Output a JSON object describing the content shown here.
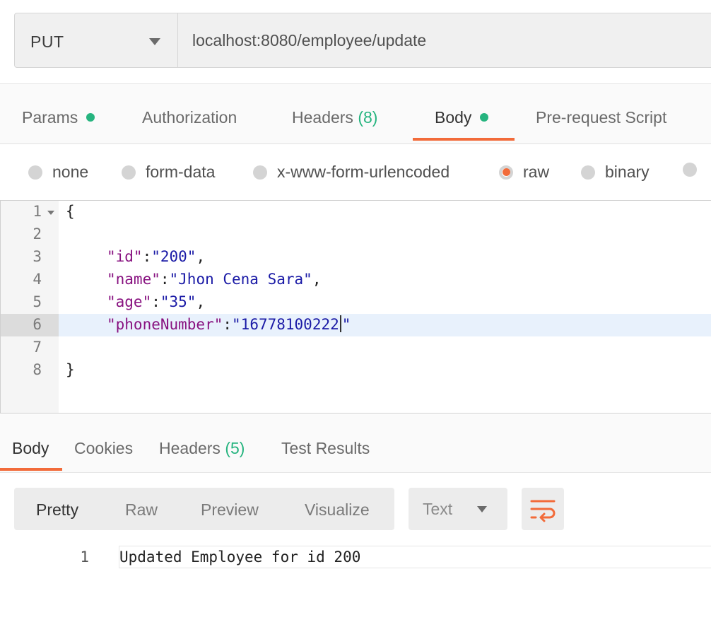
{
  "request": {
    "method": "PUT",
    "url": "localhost:8080/employee/update"
  },
  "request_tabs": {
    "params": "Params",
    "authorization": "Authorization",
    "headers": "Headers",
    "headers_count": "(8)",
    "body": "Body",
    "prerequest": "Pre-request Script",
    "active": "Body"
  },
  "body_types": {
    "none": "none",
    "form_data": "form-data",
    "urlencoded": "x-www-form-urlencoded",
    "raw": "raw",
    "binary": "binary",
    "selected": "raw"
  },
  "editor": {
    "line_numbers": [
      "1",
      "2",
      "3",
      "4",
      "5",
      "6",
      "7",
      "8"
    ],
    "active_line": "6",
    "open_brace": "{",
    "close_brace": "}",
    "fields": [
      {
        "key": "\"id\"",
        "value": "\"200\"",
        "trail": ","
      },
      {
        "key": "\"name\"",
        "value": "\"Jhon Cena Sara\"",
        "trail": ","
      },
      {
        "key": "\"age\"",
        "value": "\"35\"",
        "trail": ","
      },
      {
        "key": "\"phoneNumber\"",
        "value": "\"16778100222",
        "value_end": "\"",
        "trail": ""
      }
    ]
  },
  "response_tabs": {
    "body": "Body",
    "cookies": "Cookies",
    "headers": "Headers",
    "headers_count": "(5)",
    "test_results": "Test Results",
    "active": "Body"
  },
  "response_toolbar": {
    "pretty": "Pretty",
    "raw": "Raw",
    "preview": "Preview",
    "visualize": "Visualize",
    "format": "Text",
    "active_view": "Pretty"
  },
  "response": {
    "line_number": "1",
    "text": "Updated Employee for id 200"
  },
  "colors": {
    "accent": "#f26b3a",
    "success_dot": "#26b47f",
    "json_key": "#881280",
    "json_string": "#1a1aa6"
  }
}
